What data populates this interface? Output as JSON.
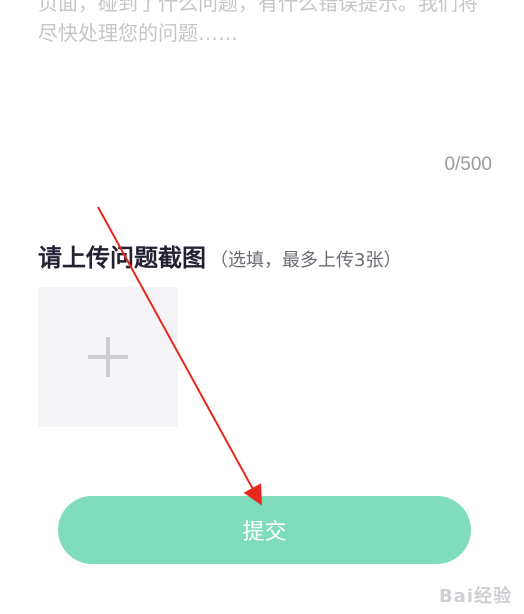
{
  "feedback": {
    "placeholder": "页面，碰到了什么问题，有什么错误提示。我们将尽快处理您的问题……",
    "char_count": "0/500"
  },
  "upload": {
    "title": "请上传问题截图",
    "hint": "（选填，最多上传3张）",
    "add_icon": "plus-icon"
  },
  "actions": {
    "submit_label": "提交",
    "submit_color": "#7fdcbd"
  },
  "annotation": {
    "arrow_color": "#e8271e"
  },
  "watermark": {
    "text": "Bai经验"
  }
}
